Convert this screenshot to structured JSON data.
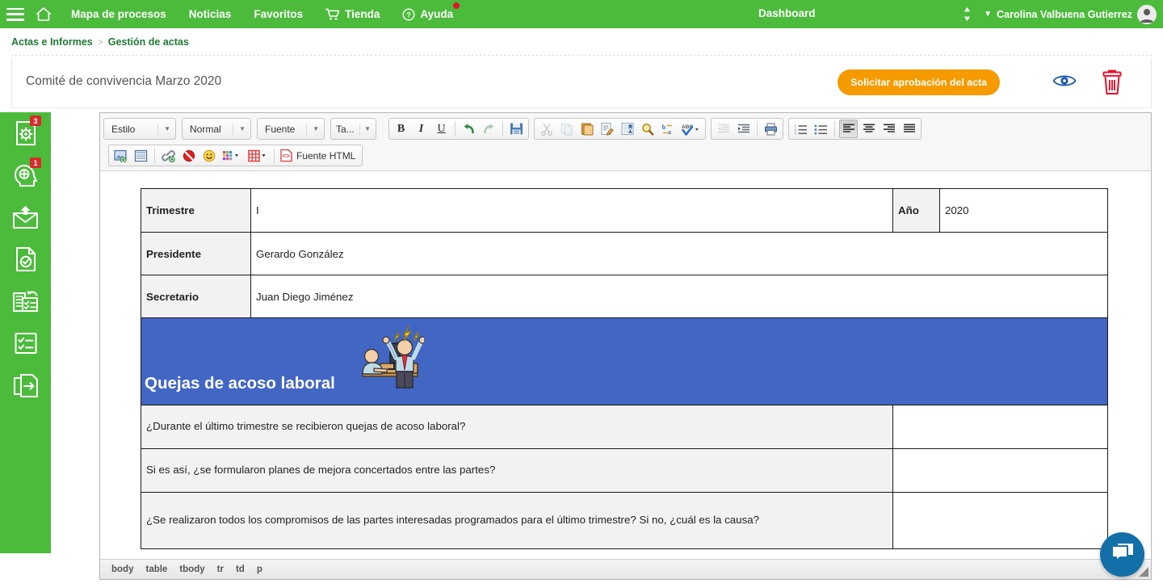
{
  "topbar": {
    "menu_icon": "hamburger-icon",
    "home_icon": "home-icon",
    "links": [
      {
        "label": "Mapa de procesos",
        "icon": ""
      },
      {
        "label": "Noticias",
        "icon": ""
      },
      {
        "label": "Favoritos",
        "icon": ""
      },
      {
        "label": "Tienda",
        "icon": "cart-icon"
      },
      {
        "label": "Ayuda",
        "icon": "help-circle-icon",
        "has_notification": true
      }
    ],
    "dashboard_label": "Dashboard",
    "sort_icon": "up-down-arrows-icon",
    "user_name": "Carolina Valbuena Gutierrez",
    "chevron_icon": "chevron-down-icon",
    "avatar_icon": "user-avatar-icon",
    "bg_color": "#4CBB3C",
    "notification_color": "#E8112D"
  },
  "breadcrumb": {
    "items": [
      "Actas e Informes",
      "Gestión de actas"
    ],
    "separator": ">",
    "link_color": "#1E7A34"
  },
  "page_header": {
    "title": "Comité de convivencia Marzo 2020",
    "approve_button": "Solicitar aprobación del acta",
    "approve_color": "#F59B00",
    "preview_icon": "eye-icon",
    "preview_color": "#1E5AA8",
    "delete_icon": "trash-icon",
    "delete_color": "#E8112D"
  },
  "sidebar": {
    "bg_color": "#4CBB3C",
    "items": [
      {
        "name": "sidebar-item-process-settings",
        "icon": "document-gear-icon",
        "badge": "3"
      },
      {
        "name": "sidebar-item-add-person",
        "icon": "head-plus-icon",
        "badge": "1"
      },
      {
        "name": "sidebar-item-mail",
        "icon": "envelope-upload-icon",
        "badge": ""
      },
      {
        "name": "sidebar-item-approved-doc",
        "icon": "document-check-icon",
        "badge": ""
      },
      {
        "name": "sidebar-item-task-refresh",
        "icon": "checklist-refresh-icon",
        "badge": ""
      },
      {
        "name": "sidebar-item-checklist",
        "icon": "checklist-icon",
        "badge": ""
      },
      {
        "name": "sidebar-item-export",
        "icon": "document-export-arrow-icon",
        "badge": ""
      }
    ]
  },
  "toolbar": {
    "combos": [
      {
        "name": "style-select",
        "label": "Estilo"
      },
      {
        "name": "format-select",
        "label": "Normal"
      },
      {
        "name": "font-select",
        "label": "Fuente"
      },
      {
        "name": "size-select",
        "label": "Ta..."
      }
    ],
    "row1_buttons": [
      {
        "name": "bold-button",
        "icon": "bold-icon",
        "glyph": "B",
        "state": "normal"
      },
      {
        "name": "italic-button",
        "icon": "italic-icon",
        "glyph": "I",
        "state": "normal"
      },
      {
        "name": "underline-button",
        "icon": "underline-icon",
        "glyph": "U",
        "state": "normal"
      },
      {
        "name": "undo-button",
        "icon": "undo-arrow-icon",
        "state": "normal"
      },
      {
        "name": "redo-button",
        "icon": "redo-arrow-icon",
        "state": "dim"
      },
      {
        "name": "save-button",
        "icon": "floppy-disk-icon",
        "state": "normal"
      },
      {
        "name": "cut-button",
        "icon": "scissors-icon",
        "state": "dim"
      },
      {
        "name": "copy-button",
        "icon": "copy-pages-icon",
        "state": "dim"
      },
      {
        "name": "paste-button",
        "icon": "clipboard-paste-icon",
        "state": "normal"
      },
      {
        "name": "paste-as-text-button",
        "icon": "paste-text-icon",
        "state": "normal"
      },
      {
        "name": "paste-from-word-button",
        "icon": "paste-word-icon",
        "state": "normal"
      },
      {
        "name": "find-button",
        "icon": "magnifier-icon",
        "state": "normal"
      },
      {
        "name": "replace-button",
        "icon": "find-replace-icon",
        "state": "normal"
      },
      {
        "name": "spellcheck-button",
        "icon": "spellcheck-abc-icon",
        "state": "normal"
      },
      {
        "name": "outdent-button",
        "icon": "decrease-indent-icon",
        "state": "dim"
      },
      {
        "name": "indent-button",
        "icon": "increase-indent-icon",
        "state": "normal"
      },
      {
        "name": "print-button",
        "icon": "printer-icon",
        "state": "normal"
      },
      {
        "name": "numbered-list-button",
        "icon": "ordered-list-icon",
        "state": "normal"
      },
      {
        "name": "bulleted-list-button",
        "icon": "unordered-list-icon",
        "state": "normal"
      },
      {
        "name": "align-left-button",
        "icon": "align-left-icon",
        "state": "active"
      },
      {
        "name": "align-center-button",
        "icon": "align-center-icon",
        "state": "normal"
      },
      {
        "name": "align-right-button",
        "icon": "align-right-icon",
        "state": "normal"
      },
      {
        "name": "align-justify-button",
        "icon": "align-justify-icon",
        "state": "normal"
      }
    ],
    "row2_buttons": [
      {
        "name": "insert-image-button",
        "icon": "image-add-icon"
      },
      {
        "name": "insert-template-button",
        "icon": "page-template-icon"
      },
      {
        "name": "insert-link-button",
        "icon": "link-add-icon"
      },
      {
        "name": "unlink-button",
        "icon": "unlink-prohibited-icon"
      },
      {
        "name": "emoji-button",
        "icon": "smiley-face-icon"
      },
      {
        "name": "text-color-button",
        "icon": "color-palette-icon"
      },
      {
        "name": "insert-table-button",
        "icon": "table-grid-icon"
      }
    ],
    "html_source_label": "Fuente HTML",
    "html_source_icon": "code-brackets-icon"
  },
  "document": {
    "info_rows": [
      {
        "label": "Trimestre",
        "value": "I"
      },
      {
        "label": "Presidente",
        "value": "Gerardo González"
      },
      {
        "label": "Secretario",
        "value": "Juan Diego Jiménez"
      }
    ],
    "year_label": "Año",
    "year_value": "2020",
    "banner": {
      "title": "Quejas de acoso laboral",
      "bg_color": "#4266C4",
      "illustration": "workplace-harassment-illustration"
    },
    "questions": [
      {
        "text": "¿Durante el último trimestre se recibieron quejas de acoso laboral?",
        "answer": ""
      },
      {
        "text": "Si es así, ¿se formularon planes de mejora concertados entre las partes?",
        "answer": ""
      },
      {
        "text": "¿Se realizaron todos los compromisos de las partes interesadas programados para el último trimestre? Si no, ¿cuál es la causa?",
        "answer": ""
      }
    ]
  },
  "statusbar": {
    "path": [
      "body",
      "table",
      "tbody",
      "tr",
      "td",
      "p"
    ]
  },
  "chat": {
    "icon": "chat-bubbles-icon",
    "color": "#136FA8"
  }
}
